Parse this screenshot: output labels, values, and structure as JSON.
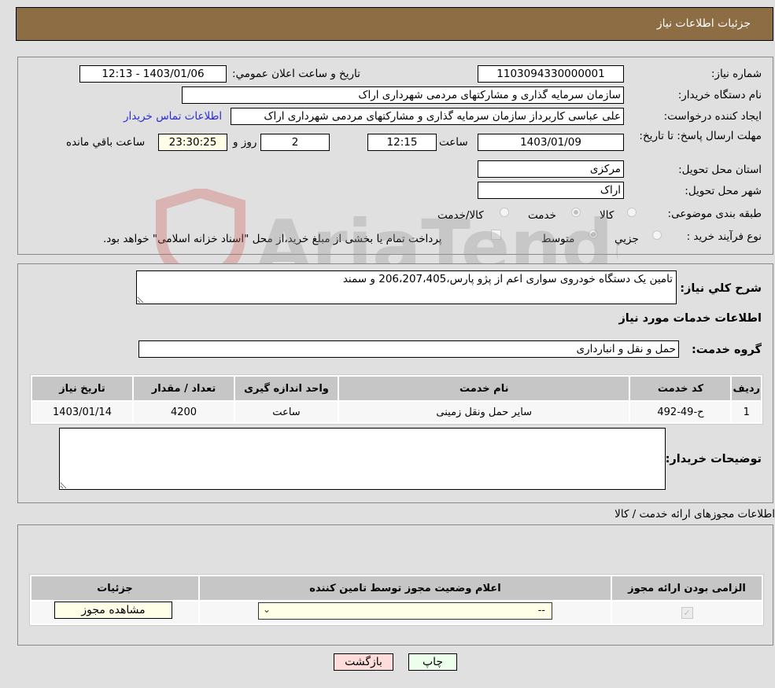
{
  "header": {
    "title": "جزئیات اطلاعات نیاز"
  },
  "form": {
    "need_number_label": "شماره نیاز:",
    "need_number": "1103094330000001",
    "announce_label": "تاریخ و ساعت اعلان عمومي:",
    "announce_value": "1403/01/06 - 12:13",
    "buyer_org_label": "نام دستگاه خریدار:",
    "buyer_org": "سازمان سرمایه گذاری و مشارکتهای مردمی شهرداری اراک",
    "creator_label": "ایجاد کننده درخواست:",
    "creator": "علی عباسی کاربرداز سازمان سرمایه گذاری و مشارکتهای مردمی شهرداری اراک",
    "contact_link": "اطلاعات تماس خریدار",
    "deadline_label": "مهلت ارسال پاسخ: تا تاریخ:",
    "deadline_date": "1403/01/09",
    "time_label": "ساعت",
    "deadline_time": "12:15",
    "days_value": "2",
    "days_label": "روز و",
    "remaining_time": "23:30:25",
    "remaining_label": "ساعت باقي مانده",
    "province_label": "استان محل تحویل:",
    "province": "مرکزی",
    "city_label": "شهر محل تحویل:",
    "city": "اراک",
    "category_label": "طبقه بندی موضوعی:",
    "category_options": [
      {
        "label": "کالا",
        "selected": false
      },
      {
        "label": "خدمت",
        "selected": true
      },
      {
        "label": "کالا/خدمت",
        "selected": false
      }
    ],
    "process_label": "نوع فرآیند خرید :",
    "process_options": [
      {
        "label": "جزيي",
        "selected": false
      },
      {
        "label": "متوسط",
        "selected": true
      }
    ],
    "treasury_note": "پرداخت تمام یا بخشی از مبلغ خرید،از محل \"اسناد خزانه اسلامی\" خواهد بود.",
    "treasury_checked": false
  },
  "description": {
    "label": "شرح کلي نياز:",
    "value": "تامین یک دستگاه خودروی سواری اعم از پژو پارس،206،207،405 و سمند",
    "services_heading": "اطلاعات خدمات مورد نیاز",
    "service_group_label": "گروه خدمت:",
    "service_group": "حمل و نقل و انبارداری"
  },
  "services_table": {
    "headers": [
      "ردیف",
      "کد خدمت",
      "نام خدمت",
      "واحد اندازه گیری",
      "تعداد / مقدار",
      "تاریخ نیاز"
    ],
    "rows": [
      [
        "1",
        "ح-49-492",
        "سایر حمل ونقل زمینی",
        "ساعت",
        "4200",
        "1403/01/14"
      ]
    ]
  },
  "buyer_notes": {
    "label": "توضیحات خریدار:",
    "value": ""
  },
  "permits": {
    "section_title": "اطلاعات مجوزهای ارائه خدمت / کالا",
    "headers": [
      "الزامی بودن ارائه مجوز",
      "اعلام وضعیت مجوز توسط تامین کننده",
      "جزئیات"
    ],
    "rows": [
      {
        "required": true,
        "status_selected": "--",
        "details_button": "مشاهده مجوز"
      }
    ]
  },
  "footer": {
    "back_button": "بازگشت",
    "print_button": "چاپ"
  },
  "watermark": {
    "text": "AriaTender.neT"
  }
}
